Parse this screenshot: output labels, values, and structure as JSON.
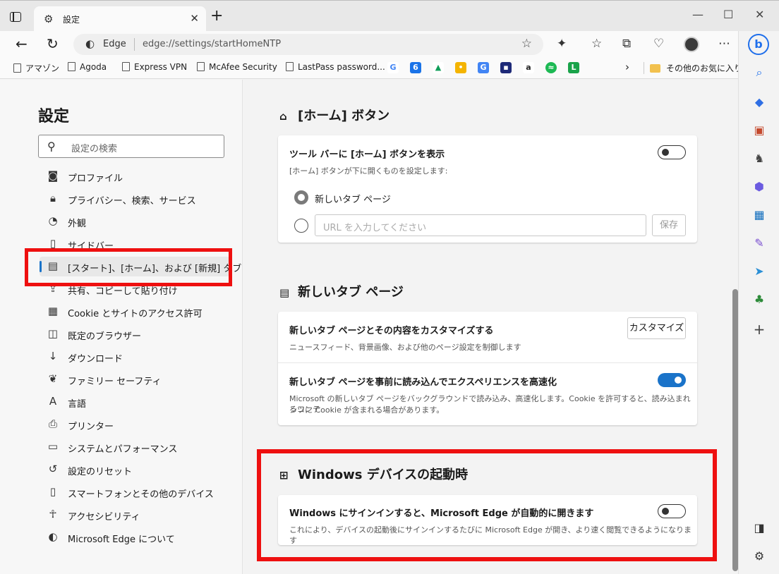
{
  "tab": {
    "title": "設定"
  },
  "address": {
    "site": "Edge",
    "url": "edge://settings/startHomeNTP"
  },
  "favorites": {
    "items": [
      "アマゾン",
      "Agoda",
      "Express VPN",
      "McAfee Security",
      "LastPass password..."
    ],
    "other": "その他のお気に入り"
  },
  "nav": {
    "title": "設定",
    "search_placeholder": "設定の検索",
    "items": [
      "プロファイル",
      "プライバシー、検索、サービス",
      "外観",
      "サイドバー",
      "[スタート]、[ホーム]、および [新規] タブ",
      "共有、コピーして貼り付け",
      "Cookie とサイトのアクセス許可",
      "既定のブラウザー",
      "ダウンロード",
      "ファミリー セーフティ",
      "言語",
      "プリンター",
      "システムとパフォーマンス",
      "設定のリセット",
      "スマートフォンとその他のデバイス",
      "アクセシビリティ",
      "Microsoft Edge について"
    ]
  },
  "home_button": {
    "title": "[ホーム] ボタン",
    "show_label": "ツール バーに [ホーム] ボタンを表示",
    "desc": "[ホーム] ボタンが下に開くものを設定します:",
    "opt_newtab": "新しいタブ ページ",
    "url_placeholder": "URL を入力してください",
    "save": "保存",
    "toggle_on": false
  },
  "new_tab": {
    "title": "新しいタブ ページ",
    "customize_title": "新しいタブ ページとその内容をカスタマイズする",
    "customize_desc": "ニュースフィード、背景画像、および他のページ設定を制御します",
    "customize_btn": "カスタマイズ",
    "preload_title": "新しいタブ ページを事前に読み込んでエクスペリエンスを高速化",
    "preload_desc_1": "Microsoft の新しいタブ ページをバックグラウンドで読み込み、高速化します。Cookie を許可すると、読み込まれるコンテ",
    "preload_desc_2": "ンツに Cookie が含まれる場合があります。",
    "preload_on": true
  },
  "startup": {
    "title": "Windows デバイスの起動時",
    "row_title": "Windows にサインインすると、Microsoft Edge が自動的に開きます",
    "row_desc": "これにより、デバイスの起動後にサインインするたびに Microsoft Edge が開き、より速く閲覧できるようになります",
    "toggle_on": false
  },
  "colors": {
    "accent": "#1a73c9",
    "highlight": "#ee1010"
  }
}
